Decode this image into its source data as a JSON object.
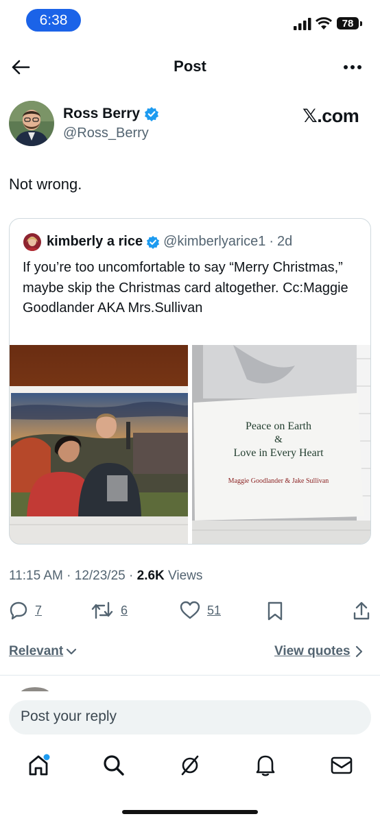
{
  "status_bar": {
    "time": "6:38",
    "battery": "78"
  },
  "header": {
    "title": "Post"
  },
  "post": {
    "author_name": "Ross Berry",
    "author_handle": "@Ross_Berry",
    "watermark": "𝕏.com",
    "text": "Not wrong.",
    "time": "11:15 AM",
    "date": "12/23/25",
    "views_count": "2.6K",
    "views_label": "Views"
  },
  "quote": {
    "author_name": "kimberly a rice",
    "author_handle": "@kimberlyarice1",
    "age": "2d",
    "text": "If you’re too uncomfortable to say “Merry Christmas,” maybe skip the Christmas card altogether. Cc:Maggie Goodlander AKA Mrs.Sullivan",
    "card_line1": "Peace on Earth",
    "card_amp": "&",
    "card_line2": "Love in Every Heart",
    "card_signature": "Maggie Goodlander & Jake Sullivan"
  },
  "actions": {
    "replies": "7",
    "reposts": "6",
    "likes": "51"
  },
  "filters": {
    "sort_label": "Relevant",
    "view_quotes": "View quotes"
  },
  "reply_box": {
    "placeholder": "Post your reply"
  },
  "colors": {
    "accent": "#1d9bf0",
    "verified": "#1d9bf0",
    "time_pill": "#1b63e8",
    "muted": "#536471"
  },
  "icons": [
    "back-arrow-icon",
    "more-icon",
    "verified-badge-icon",
    "reply-icon",
    "repost-icon",
    "like-icon",
    "bookmark-icon",
    "share-icon",
    "home-icon",
    "search-icon",
    "grok-icon",
    "notifications-icon",
    "messages-icon"
  ]
}
